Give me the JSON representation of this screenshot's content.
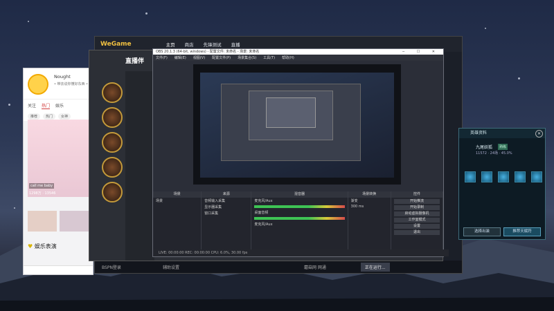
{
  "colors": {
    "accent": "#f0c040",
    "obs_bg": "#2b2e38",
    "danger": "#d64a4a"
  },
  "phone": {
    "username": "Nought",
    "subtitle": "• 带去说你懂好东西 •",
    "tabs": [
      "关注",
      "热门",
      "娱乐"
    ],
    "active_tab": "热门",
    "tags": [
      "推荐",
      "热门",
      "女神"
    ],
    "card_caption": "call me baby",
    "card_count": "1298万 · 13546",
    "section_title": "娱乐表演"
  },
  "wegame": {
    "logo": "WeGame",
    "nav": [
      "主页",
      "商店",
      "先锋测试",
      "直播"
    ],
    "footer_left": "BSPN登录",
    "footer_mid": "辅助设置",
    "footer_right": "蘑菇网  网通",
    "footer_btn": "正在运行..."
  },
  "live": {
    "title": "直播伴"
  },
  "obs": {
    "title": "OBS 20.1.3 (64-bit, windows) - 配置文件: 未命名 - 场景: 未命名",
    "menu": [
      "文件(F)",
      "编辑(E)",
      "视图(V)",
      "配置文件(P)",
      "场景集合(S)",
      "工具(T)",
      "帮助(H)"
    ],
    "panels": {
      "scenes": "场景",
      "sources": "来源",
      "mixer": "混音器",
      "transitions": "场景转换",
      "controls": "控件"
    },
    "scene_item": "场景",
    "source_items": [
      "音频输入采集",
      "显示器采集",
      "窗口采集"
    ],
    "mixer_items": [
      "麦克风/Aux",
      "桌面音频",
      "麦克风/Aux"
    ],
    "mixer_values": [
      "-0.1 dB",
      "0.0 dB",
      "-0.1 dB"
    ],
    "transition_value": "渐变",
    "transition_duration": "300 ms",
    "controls": [
      "开始推流",
      "开始录制",
      "启动虚拟摄像机",
      "工作室模式",
      "设置",
      "退出"
    ],
    "status": "LIVE: 00:00:00   REC: 00:00:00   CPU: 6.0%, 30.00 fps"
  },
  "hero_data": {
    "title": "英雄资料",
    "name": "九尾妖狐",
    "tag": "熟练",
    "stats": "11572 · 24场 · 45.0%",
    "btn_left": "选择出装",
    "btn_right": "推荐天赋符"
  }
}
